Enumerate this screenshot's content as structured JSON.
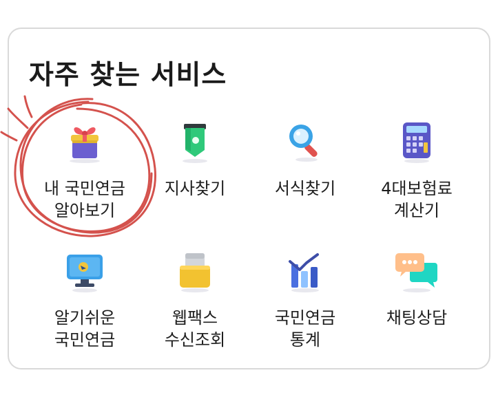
{
  "section": {
    "title": "자주 찾는 서비스"
  },
  "services": [
    {
      "line1": "내 국민연금",
      "line2": "알아보기",
      "icon": "gift-icon"
    },
    {
      "line1": "지사찾기",
      "line2": "",
      "icon": "location-pin-icon"
    },
    {
      "line1": "서식찾기",
      "line2": "",
      "icon": "magnifier-icon"
    },
    {
      "line1": "4대보험료",
      "line2": "계산기",
      "icon": "calculator-icon"
    },
    {
      "line1": "알기쉬운",
      "line2": "국민연금",
      "icon": "monitor-icon"
    },
    {
      "line1": "웹팩스",
      "line2": "수신조회",
      "icon": "fax-icon"
    },
    {
      "line1": "국민연금",
      "line2": "통계",
      "icon": "bar-chart-icon"
    },
    {
      "line1": "채팅상담",
      "line2": "",
      "icon": "chat-bubbles-icon"
    }
  ],
  "colors": {
    "annotation_circle": "#d0403a",
    "card_border": "#d9d9d9"
  }
}
